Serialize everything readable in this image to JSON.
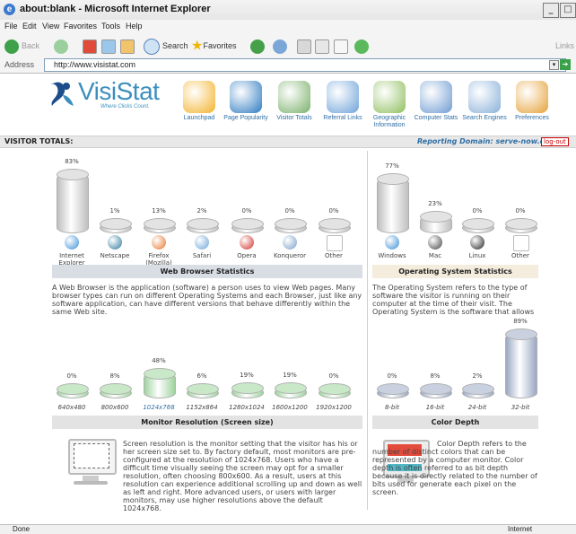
{
  "window": {
    "title": "about:blank - Microsoft Internet Explorer"
  },
  "menu": [
    "File",
    "Edit",
    "View",
    "Favorites",
    "Tools",
    "Help"
  ],
  "toolbar": {
    "back": "Back",
    "search": "Search",
    "favorites": "Favorites",
    "links": "Links"
  },
  "address": {
    "label": "Address",
    "url": "http://www.visistat.com"
  },
  "logo": {
    "brand": "VisiStat",
    "tagline": "Where Clicks Count."
  },
  "nav": [
    {
      "label": "Launchpad",
      "icon": "rocket-icon"
    },
    {
      "label": "Page Popularity",
      "icon": "book-icon"
    },
    {
      "label": "Visitor Totals",
      "icon": "bar-chart-icon"
    },
    {
      "label": "Referral Links",
      "icon": "signpost-icon"
    },
    {
      "label": "Geographic Information",
      "icon": "globe-icon"
    },
    {
      "label": "Computer Stats",
      "icon": "computer-icon"
    },
    {
      "label": "Search Engines",
      "icon": "magnifier-icon"
    },
    {
      "label": "Preferences",
      "icon": "gears-icon"
    }
  ],
  "section": {
    "left": "VISITOR TOTALS:",
    "reporting_label": "Reporting Domain:",
    "domain": "serve-now.com",
    "logout": "log-out"
  },
  "browsers": {
    "title": "Web Browser Statistics",
    "items": [
      {
        "name": "Internet Explorer",
        "pct": "83%",
        "value": 83
      },
      {
        "name": "Netscape",
        "pct": "1%",
        "value": 1
      },
      {
        "name": "Firefox (Mozilla)",
        "pct": "13%",
        "value": 13
      },
      {
        "name": "Safari",
        "pct": "2%",
        "value": 2
      },
      {
        "name": "Opera",
        "pct": "0%",
        "value": 0
      },
      {
        "name": "Konqueror",
        "pct": "0%",
        "value": 0
      },
      {
        "name": "Other",
        "pct": "0%",
        "value": 0
      }
    ],
    "desc": "A Web Browser is the application (software) a person uses to view Web pages. Many browser types can run on different Operating Systems and each Browser, just like any software application, can have different versions that behave differently within the same Web site."
  },
  "os": {
    "title": "Operating System Statistics",
    "items": [
      {
        "name": "Windows",
        "pct": "77%",
        "value": 77
      },
      {
        "name": "Mac",
        "pct": "23%",
        "value": 23
      },
      {
        "name": "Linux",
        "pct": "0%",
        "value": 0
      },
      {
        "name": "Other",
        "pct": "0%",
        "value": 0
      }
    ],
    "desc": "The Operating System refers to the type of software the visitor is running on their computer at the time of their visit. The Operating System is the software that allows"
  },
  "resolution": {
    "title": "Monitor Resolution (Screen size)",
    "items": [
      {
        "name": "640x480",
        "pct": "0%",
        "value": 0
      },
      {
        "name": "800x600",
        "pct": "8%",
        "value": 8
      },
      {
        "name": "1024x768",
        "pct": "48%",
        "value": 48
      },
      {
        "name": "1152x864",
        "pct": "6%",
        "value": 6
      },
      {
        "name": "1280x1024",
        "pct": "19%",
        "value": 19
      },
      {
        "name": "1600x1200",
        "pct": "19%",
        "value": 19
      },
      {
        "name": "1920x1200",
        "pct": "0%",
        "value": 0
      }
    ],
    "desc": "Screen resolution is the monitor setting that the visitor has his or her screen size set to. By factory default, most monitors are pre-configured at the resolution of 1024x768. Users who have a difficult time visually seeing the screen may opt for a smaller resolution, often choosing 800x600. As a result, users at this resolution can experience additional scrolling up and down as well as left and right. More advanced users, or users with larger monitors, may use higher resolutions above the default 1024x768."
  },
  "depth": {
    "title": "Color Depth",
    "items": [
      {
        "name": "8-bit",
        "pct": "0%",
        "value": 0
      },
      {
        "name": "16-bit",
        "pct": "8%",
        "value": 8
      },
      {
        "name": "24-bit",
        "pct": "2%",
        "value": 2
      },
      {
        "name": "32-bit",
        "pct": "89%",
        "value": 89
      }
    ],
    "desc": "Color Depth refers to the number of distinct colors that can be represented by a computer monitor. Color depth is often referred to as bit depth because it is directly related to the number of bits used for generate each pixel on the screen."
  },
  "statusbar": {
    "left": "Done",
    "right": "Internet"
  },
  "colors": {
    "accent": "#2f6fa4",
    "brand": "#3c8fbd",
    "grey_bar": "#cfcfcf",
    "green_bar": "#a8d9a8",
    "blue_bar": "#aeb9cc"
  }
}
